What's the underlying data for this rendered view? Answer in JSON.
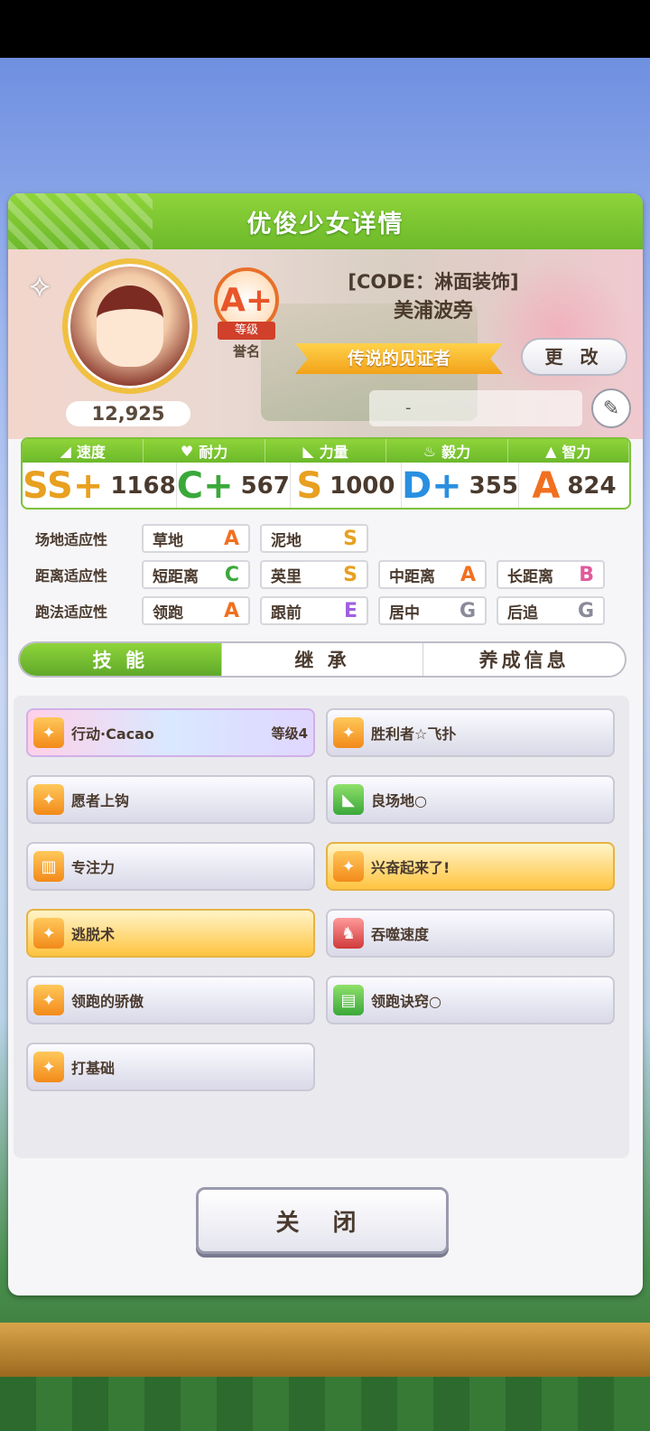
{
  "dialog": {
    "title": "优俊少女详情"
  },
  "profile": {
    "code_title": "[CODE：淋面装饰]",
    "name": "美浦波旁",
    "rank_grade": "A+",
    "rank_label": "等级",
    "rank_sub": "誉名",
    "fans": "12,925",
    "title_badge": "传说的见证者",
    "change_label": "更 改",
    "memo": "-"
  },
  "stats": [
    {
      "label": "速度",
      "grade": "SS+",
      "value": "1168",
      "color": "#e8a020"
    },
    {
      "label": "耐力",
      "grade": "C+",
      "value": "567",
      "color": "#3aa83a"
    },
    {
      "label": "力量",
      "grade": "S",
      "value": "1000",
      "color": "#e8a020"
    },
    {
      "label": "毅力",
      "grade": "D+",
      "value": "355",
      "color": "#2a8fe0"
    },
    {
      "label": "智力",
      "grade": "A",
      "value": "824",
      "color": "#f07020"
    }
  ],
  "aptitudes": {
    "track": {
      "label": "场地适应性",
      "items": [
        {
          "name": "草地",
          "grade": "A"
        },
        {
          "name": "泥地",
          "grade": "S"
        }
      ]
    },
    "distance": {
      "label": "距离适应性",
      "items": [
        {
          "name": "短距离",
          "grade": "C"
        },
        {
          "name": "英里",
          "grade": "S"
        },
        {
          "name": "中距离",
          "grade": "A"
        },
        {
          "name": "长距离",
          "grade": "B"
        }
      ]
    },
    "style": {
      "label": "跑法适应性",
      "items": [
        {
          "name": "领跑",
          "grade": "A"
        },
        {
          "name": "跟前",
          "grade": "E"
        },
        {
          "name": "居中",
          "grade": "G"
        },
        {
          "name": "后追",
          "grade": "G"
        }
      ]
    }
  },
  "tabs": [
    "技 能",
    "继 承",
    "养成信息"
  ],
  "skills": [
    {
      "name": "行动·Cacao",
      "level": "等级4",
      "style": "rainbow",
      "icon": "runner-icon"
    },
    {
      "name": "胜利者☆飞扑",
      "level": "",
      "style": "normal",
      "icon": "runner-icon"
    },
    {
      "name": "愿者上钩",
      "level": "",
      "style": "normal",
      "icon": "runner-icon"
    },
    {
      "name": "良场地○",
      "level": "",
      "style": "normal",
      "icon": "muscle-icon"
    },
    {
      "name": "专注力",
      "level": "",
      "style": "normal",
      "icon": "gate-icon"
    },
    {
      "name": "兴奋起来了!",
      "level": "",
      "style": "gold",
      "icon": "runner-icon"
    },
    {
      "name": "逃脱术",
      "level": "",
      "style": "gold",
      "icon": "runner-icon"
    },
    {
      "name": "吞噬速度",
      "level": "",
      "style": "normal",
      "icon": "beast-icon"
    },
    {
      "name": "领跑的骄傲",
      "level": "",
      "style": "normal",
      "icon": "runner-icon"
    },
    {
      "name": "领跑诀窍○",
      "level": "",
      "style": "normal",
      "icon": "book-icon"
    },
    {
      "name": "打基础",
      "level": "",
      "style": "normal",
      "icon": "runner-icon"
    }
  ],
  "close_label": "关 闭"
}
